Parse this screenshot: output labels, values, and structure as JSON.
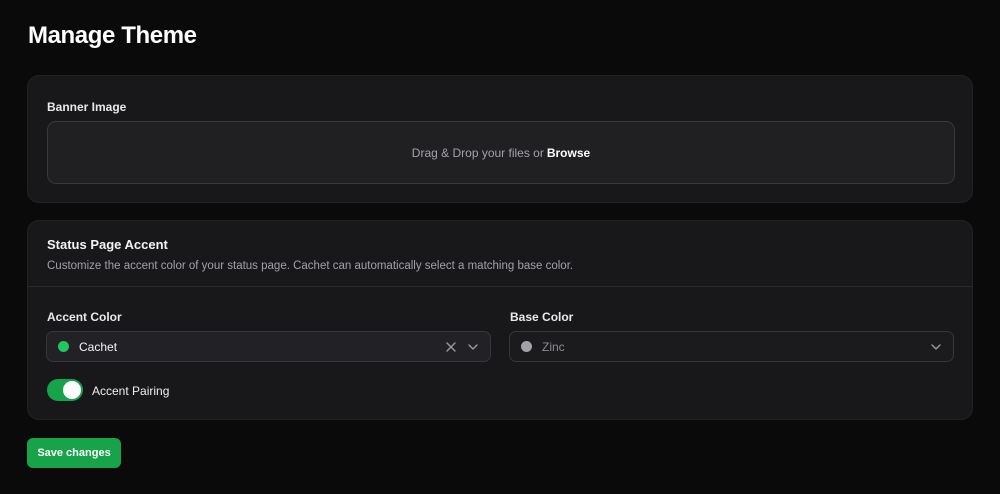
{
  "page": {
    "title": "Manage Theme"
  },
  "banner": {
    "label": "Banner Image",
    "dropzone_text": "Drag & Drop your files or",
    "browse_label": "Browse"
  },
  "accent_section": {
    "title": "Status Page Accent",
    "description": "Customize the accent color of your status page. Cachet can automatically select a matching base color.",
    "accent_color": {
      "label": "Accent Color",
      "value": "Cachet",
      "swatch": "#22c55e",
      "icons": [
        "close-icon",
        "chevron-down-icon"
      ]
    },
    "base_color": {
      "label": "Base Color",
      "value": "Zinc",
      "swatch": "#a1a1aa",
      "icons": [
        "chevron-down-icon"
      ]
    },
    "pairing": {
      "label": "Accent Pairing",
      "enabled": true
    }
  },
  "actions": {
    "save_label": "Save changes"
  },
  "colors": {
    "primary": "#16a34a",
    "background": "#0a0a0b",
    "card": "#18181b"
  }
}
